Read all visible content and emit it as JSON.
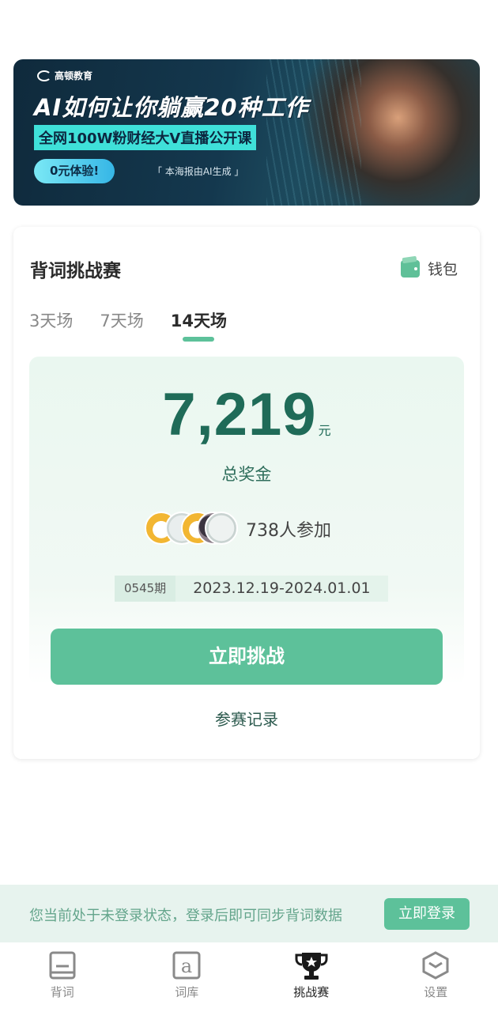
{
  "banner": {
    "logo": "高顿教育",
    "headline": "AI如何让你躺赢20种工作",
    "subline": "全网100W粉财经大V直播公开课",
    "cta": "0元体验!",
    "note": "「 本海报由AI生成 」"
  },
  "challenge": {
    "title": "背词挑战赛",
    "wallet_label": "钱包",
    "tabs": [
      {
        "label": "3天场",
        "active": false
      },
      {
        "label": "7天场",
        "active": false
      },
      {
        "label": "14天场",
        "active": true
      }
    ],
    "amount": "7,219",
    "amount_unit": "元",
    "prize_label": "总奖金",
    "participants": "738人参加",
    "issue": "0545期",
    "dates": "2023.12.19-2024.01.01",
    "cta": "立即挑战",
    "records": "参赛记录"
  },
  "login_bar": {
    "message": "您当前处于未登录状态，登录后即可同步背词数据",
    "button": "立即登录"
  },
  "tabbar": {
    "items": [
      {
        "label": "背词",
        "icon": "book-icon",
        "active": false
      },
      {
        "label": "词库",
        "icon": "letter-a-icon",
        "active": false
      },
      {
        "label": "挑战赛",
        "icon": "trophy-icon",
        "active": true
      },
      {
        "label": "设置",
        "icon": "hexagon-settings-icon",
        "active": false
      }
    ]
  },
  "colors": {
    "accent": "#5dc19a",
    "amount_text": "#1f6b58",
    "login_bar_bg": "#e7f3ee"
  }
}
